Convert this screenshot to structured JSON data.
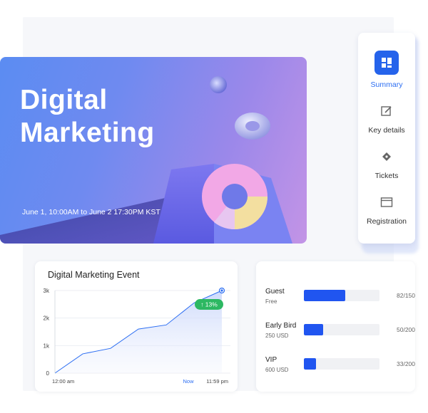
{
  "hero": {
    "title_line1": "Digital",
    "title_line2": "Marketing",
    "date": "June 1, 10:00AM to June 2 17:30PM KST"
  },
  "nav": {
    "items": [
      {
        "label": "Summary",
        "icon": "grid-icon",
        "active": true
      },
      {
        "label": "Key details",
        "icon": "edit-icon",
        "active": false
      },
      {
        "label": "Tickets",
        "icon": "ticket-icon",
        "active": false
      },
      {
        "label": "Registration",
        "icon": "window-icon",
        "active": false
      }
    ]
  },
  "chart": {
    "title": "Digital Marketing Event",
    "badge": "↑ 13%"
  },
  "chart_data": {
    "type": "area",
    "title": "Digital Marketing Event",
    "y_ticks": [
      "0",
      "1k",
      "2k",
      "3k"
    ],
    "ylim": [
      0,
      3000
    ],
    "x_tick_labels": [
      "12:00 am",
      "Now",
      "11:59 pm"
    ],
    "series": [
      {
        "values": [
          0,
          700,
          900,
          1600,
          1750,
          2550,
          3000
        ]
      }
    ],
    "grid": true,
    "color": "#2c6ef2"
  },
  "tickets": [
    {
      "name": "Guest",
      "price": "Free",
      "sold": 82,
      "total": 150,
      "count": "82/150"
    },
    {
      "name": "Early Bird",
      "price": "250 USD",
      "sold": 50,
      "total": 200,
      "count": "50/200"
    },
    {
      "name": "VIP",
      "price": "600 USD",
      "sold": 33,
      "total": 200,
      "count": "33/200"
    }
  ],
  "colors": {
    "accent": "#2563eb",
    "bar": "#2055f0",
    "badge": "#2db862"
  }
}
